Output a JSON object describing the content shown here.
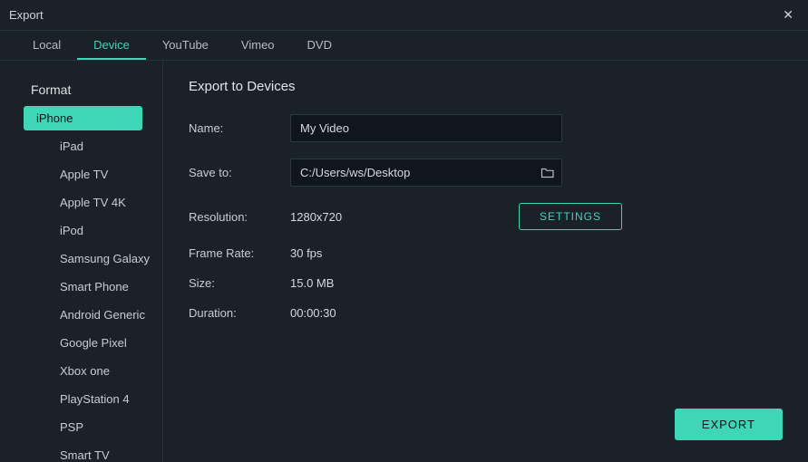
{
  "window": {
    "title": "Export",
    "close_glyph": "✕"
  },
  "tabs": [
    {
      "label": "Local",
      "active": false
    },
    {
      "label": "Device",
      "active": true
    },
    {
      "label": "YouTube",
      "active": false
    },
    {
      "label": "Vimeo",
      "active": false
    },
    {
      "label": "DVD",
      "active": false
    }
  ],
  "sidebar": {
    "heading": "Format",
    "items": [
      {
        "label": "iPhone",
        "selected": true
      },
      {
        "label": "iPad",
        "selected": false
      },
      {
        "label": "Apple TV",
        "selected": false
      },
      {
        "label": "Apple TV 4K",
        "selected": false
      },
      {
        "label": "iPod",
        "selected": false
      },
      {
        "label": "Samsung Galaxy",
        "selected": false
      },
      {
        "label": "Smart Phone",
        "selected": false
      },
      {
        "label": "Android Generic",
        "selected": false
      },
      {
        "label": "Google Pixel",
        "selected": false
      },
      {
        "label": "Xbox one",
        "selected": false
      },
      {
        "label": "PlayStation 4",
        "selected": false
      },
      {
        "label": "PSP",
        "selected": false
      },
      {
        "label": "Smart TV",
        "selected": false
      }
    ]
  },
  "main": {
    "title": "Export to Devices",
    "name_label": "Name:",
    "name_value": "My Video",
    "saveto_label": "Save to:",
    "saveto_value": "C:/Users/ws/Desktop",
    "resolution_label": "Resolution:",
    "resolution_value": "1280x720",
    "settings_button": "SETTINGS",
    "framerate_label": "Frame Rate:",
    "framerate_value": "30 fps",
    "size_label": "Size:",
    "size_value": "15.0 MB",
    "duration_label": "Duration:",
    "duration_value": "00:00:30",
    "export_button": "EXPORT"
  },
  "colors": {
    "accent": "#3fd6b8",
    "bg": "#1a2129",
    "input_bg": "#10161d"
  }
}
